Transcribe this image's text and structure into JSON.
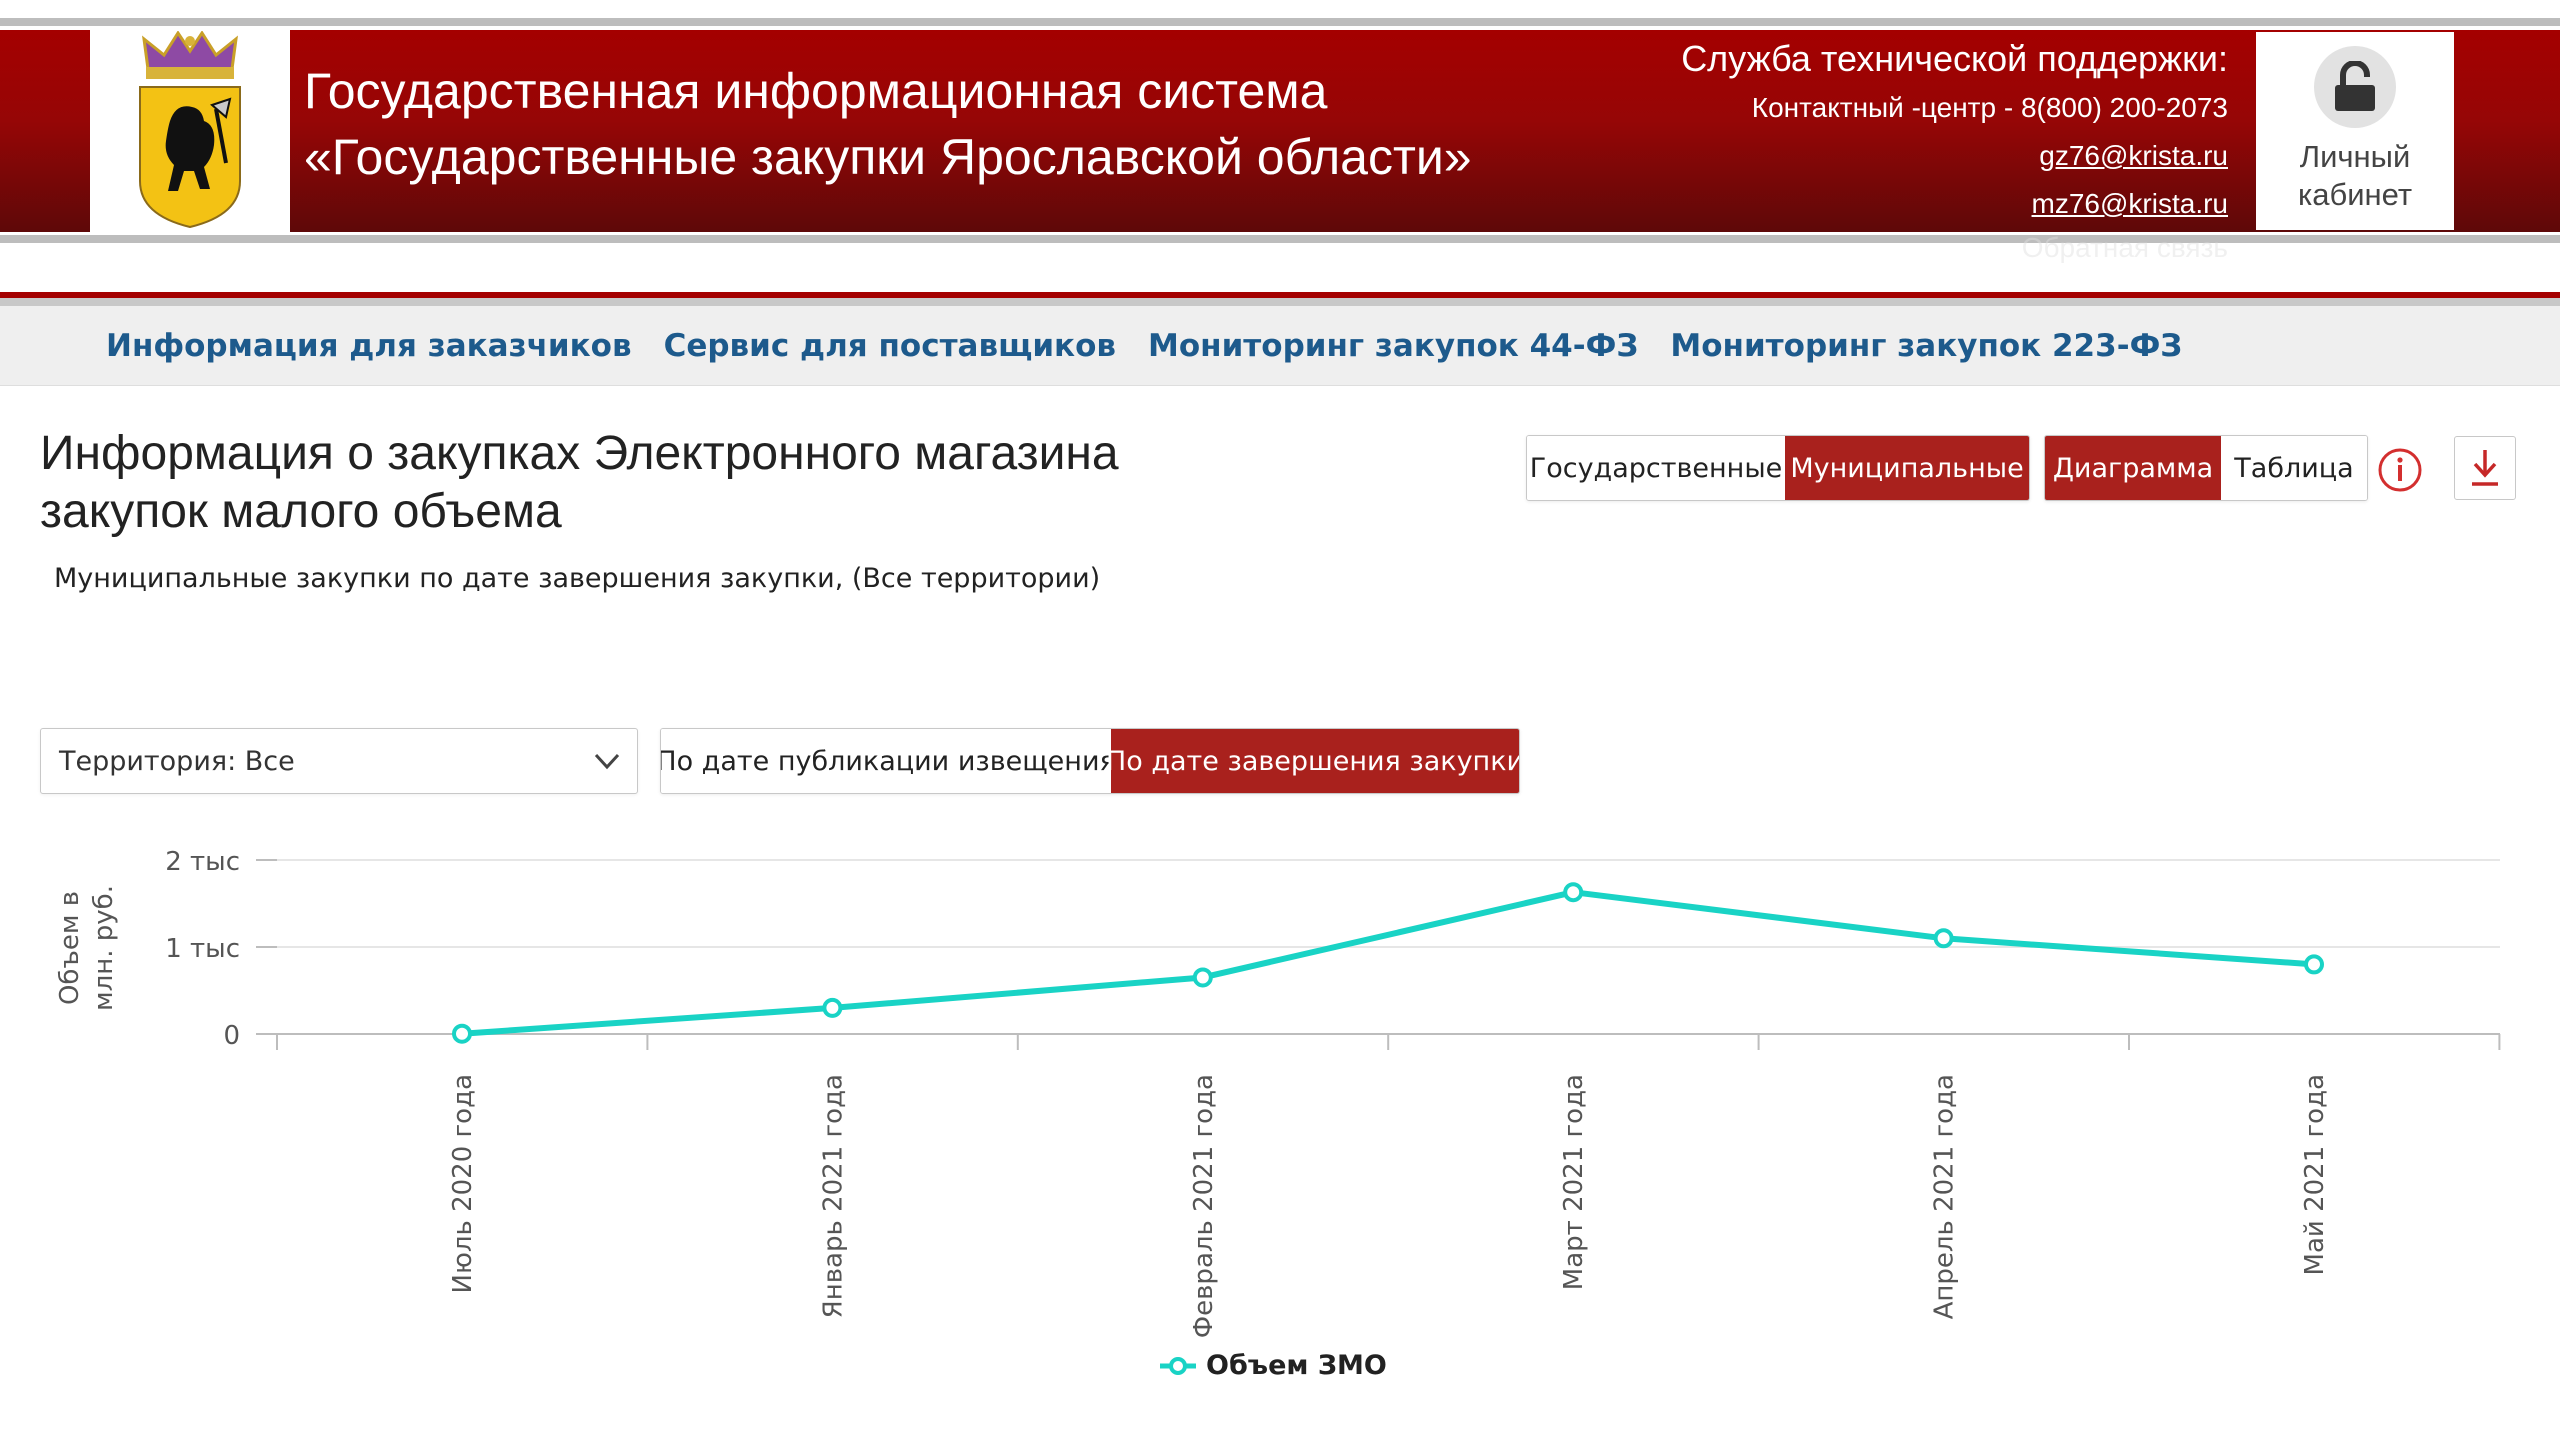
{
  "header": {
    "title_line1": "Государственная информационная система",
    "title_line2": "«Государственные закупки Ярославской области»",
    "support": {
      "title": "Служба технической поддержки:",
      "contact": "Контактный -центр - 8(800) 200-2073",
      "email1": "gz76@krista.ru",
      "email2": "mz76@krista.ru",
      "feedback": "Обратная связь"
    },
    "cabinet_line1": "Личный",
    "cabinet_line2": "кабинет",
    "logo_icon": "yaroslavl-coat-of-arms",
    "cabinet_icon": "lock-open-icon"
  },
  "nav": {
    "items": [
      "Информация для заказчиков",
      "Сервис для поставщиков",
      "Мониторинг закупок 44-ФЗ",
      "Мониторинг закупок 223-ФЗ"
    ]
  },
  "page": {
    "title": "Информация о закупках Электронного магазина закупок малого объема",
    "subtitle": "Муниципальные закупки по дате завершения закупки, (Все территории)"
  },
  "controls": {
    "type_toggle": {
      "options": [
        "Государственные",
        "Муниципальные"
      ],
      "selected": "Муниципальные"
    },
    "view_toggle": {
      "options": [
        "Диаграмма",
        "Таблица"
      ],
      "selected": "Диаграмма"
    },
    "territory_select": {
      "value": "Территория: Все"
    },
    "date_toggle": {
      "options": [
        "По дате публикации извещения",
        "По дате завершения закупки"
      ],
      "selected": "По дате завершения закупки"
    }
  },
  "colors": {
    "accent": "#a9211d",
    "header_red": "#a40000",
    "nav_text": "#1d5a8c",
    "series": "#19d3c5"
  },
  "chart_data": {
    "type": "line",
    "categories": [
      "Июль 2020 года",
      "Январь 2021 года",
      "Февраль 2021 года",
      "Март 2021 года",
      "Апрель 2021 года",
      "Май 2021 года"
    ],
    "series": [
      {
        "name": "Объем ЗМО",
        "values": [
          3,
          300,
          650,
          1630,
          1100,
          800
        ]
      }
    ],
    "ylabel": "Объем в млн. руб.",
    "ylabel_lines": [
      "Объем в",
      "млн. руб."
    ],
    "yticks": [
      0,
      1000,
      2000
    ],
    "ytick_labels": [
      "0",
      "1 тыс",
      "2 тыс"
    ],
    "ylim": [
      0,
      2000
    ],
    "grid": true,
    "legend": "bottom-center"
  }
}
